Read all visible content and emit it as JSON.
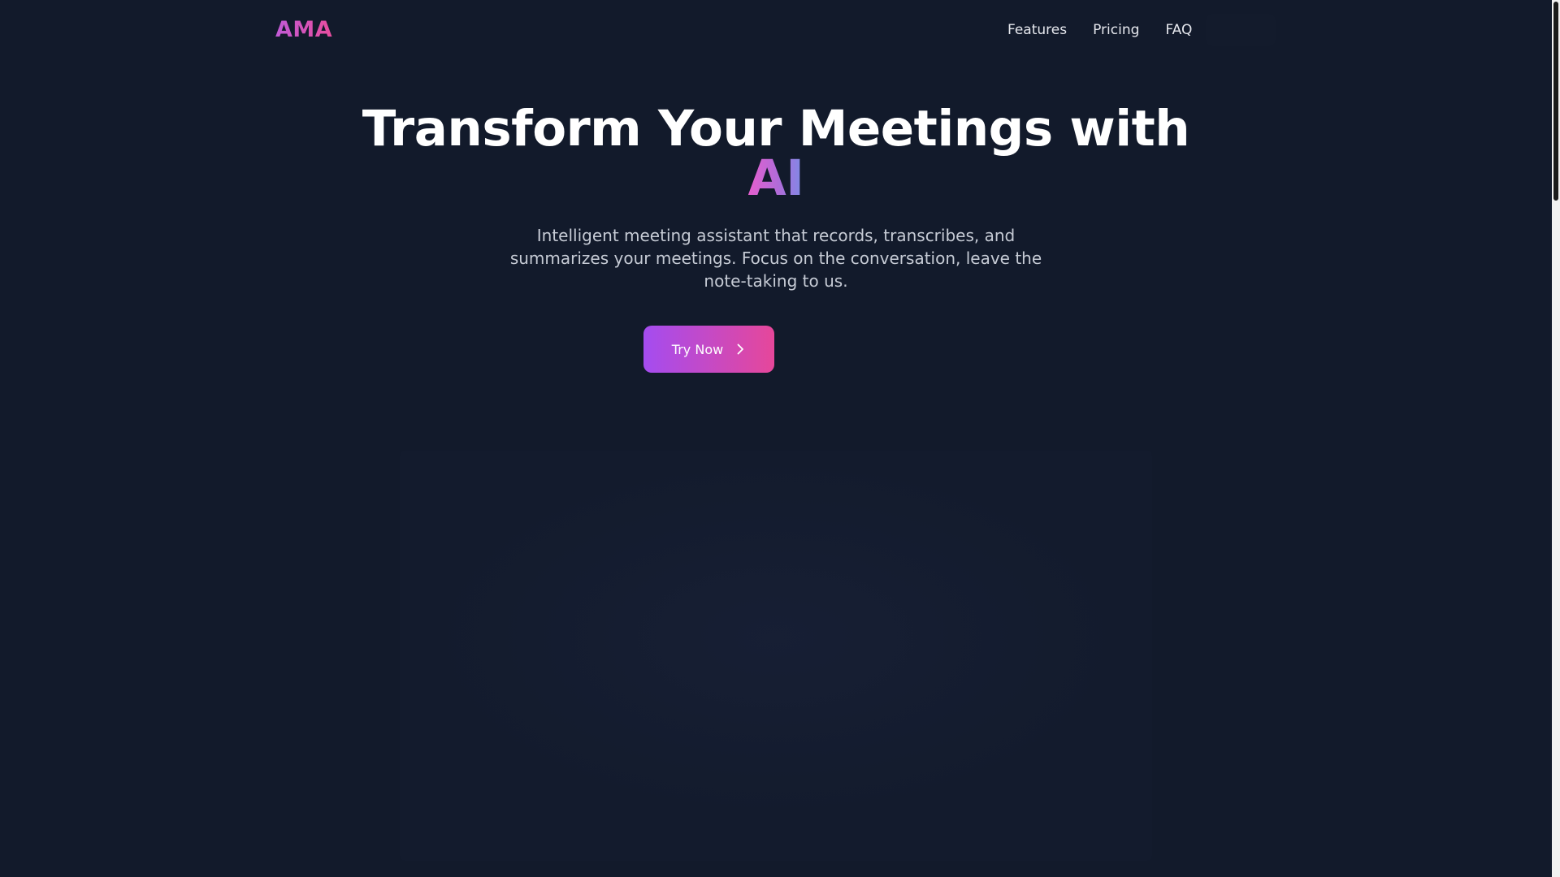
{
  "brand": {
    "name": "AMA"
  },
  "nav": {
    "items": [
      {
        "label": "Features"
      },
      {
        "label": "Pricing"
      },
      {
        "label": "FAQ"
      }
    ]
  },
  "hero": {
    "title_main": "Transform Your Meetings with",
    "title_accent": "AI",
    "subtitle": "Intelligent meeting assistant that records, transcribes, and summarizes your meetings. Focus on the conversation, leave the note-taking to us.",
    "cta_label": "Try Now",
    "cta_icon": "chevron-right-icon"
  },
  "colors": {
    "background": "#121a2b",
    "brand_gradient_start": "#c05ad6",
    "brand_gradient_end": "#e84d9e",
    "cta_gradient_start": "#a44cf0",
    "cta_gradient_end": "#e6479a",
    "accent_gradient_end": "#7d8be6"
  }
}
